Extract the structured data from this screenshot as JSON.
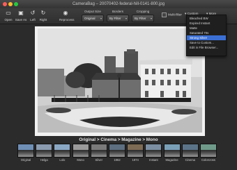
{
  "window": {
    "title": "CameraBag – 20070402-federal-hill-0141-800.jpg"
  },
  "toolbar": {
    "open": "Open",
    "save_as": "Save As",
    "left": "Left",
    "right": "Right",
    "reprocess": "Reprocess",
    "output_size_label": "Output Size",
    "output_size_value": "Original",
    "borders_label": "Borders",
    "borders_value": "By Filter",
    "cropping_label": "Cropping",
    "cropping_value": "By Filter",
    "multi_filter": "Multi-filter",
    "custom": "Custom",
    "more": "More"
  },
  "menu": {
    "items": [
      "Bleached BW",
      "Expired Instant",
      "Matte",
      "Saturated 70s",
      "Strong Silver",
      "Save to Custom...",
      "Edit in File Browser..."
    ],
    "selected": "Strong Silver"
  },
  "caption": "Original > Cinema > Magazine > Mono",
  "filmstrip": {
    "items": [
      {
        "label": "Original",
        "color": "#6f8fb5"
      },
      {
        "label": "Helga",
        "color": "#8b9bb0"
      },
      {
        "label": "Lolo",
        "color": "#8aa8c4"
      },
      {
        "label": "Mono",
        "color": "#9a9a9a"
      },
      {
        "label": "Silver",
        "color": "#7a7a7a"
      },
      {
        "label": "1962",
        "color": "#5d6f80"
      },
      {
        "label": "1974",
        "color": "#7d6b55"
      },
      {
        "label": "Instant",
        "color": "#7c8fa2"
      },
      {
        "label": "Magazine",
        "color": "#7aa0b8"
      },
      {
        "label": "Cinema",
        "color": "#5c7488"
      },
      {
        "label": "Colorcross",
        "color": "#6f9a8a"
      }
    ]
  }
}
